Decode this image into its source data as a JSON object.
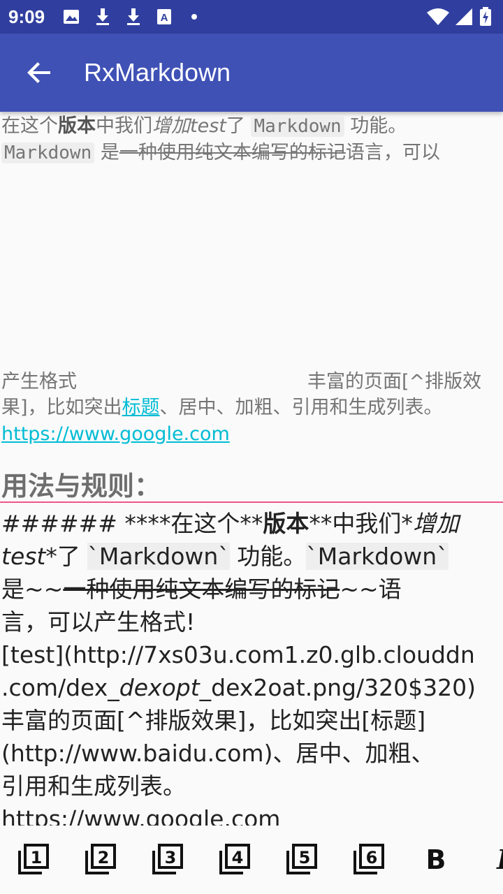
{
  "status_bar": {
    "time": "9:09",
    "icons": [
      "image-icon",
      "download-icon",
      "download-icon",
      "font-icon",
      "dot-icon",
      "wifi-icon",
      "battery-icon"
    ]
  },
  "app_bar": {
    "title": "RxMarkdown",
    "back_icon": "arrow-back-icon",
    "color": "#3f51b5",
    "status_color": "#303f9f"
  },
  "preview": {
    "line1": {
      "a": "在这个",
      "b": "版本",
      "c": "中我们",
      "d": "增加test",
      "e": "了",
      "f": "Markdown",
      "g": "功能。"
    },
    "line2": {
      "a": "Markdown",
      "b": "是",
      "c": "一种使用纯文本编写的标记",
      "d": "语言，可以"
    },
    "line3": {
      "a": "产生格式",
      "b": "丰富的页面[^排版效"
    },
    "line4": {
      "a": "果]，比如突出",
      "b": "标题",
      "c": "、居中、加粗、引用和生成列表。"
    },
    "line5": "https://www.google.com",
    "heading": "用法与规则：",
    "link_color": "#00bcd4"
  },
  "editor": {
    "lines": [
      {
        "a": "###### ",
        "b": "****",
        "c": "在这个**",
        "d": "版本",
        "e": "**中我们*",
        "f": "增加"
      },
      {
        "a": "test",
        "b": "*了 ",
        "c": "`Markdown`",
        "d": " 功能。",
        "e": "`Markdown`"
      },
      {
        "a": "是~~",
        "b": "一种使用纯文本编写的标记",
        "c": "~~语"
      },
      {
        "a": "言，可以产生格式!"
      },
      {
        "a": "[test](http://7xs03u.com1.z0.glb.clouddn"
      },
      {
        "a": ".com/dex_",
        "b": "dexopt",
        "c": "_dex2oat.png/320$320)"
      },
      {
        "a": "丰富的页面[^排版效果]，比如突出[标题]"
      },
      {
        "a": "(http://www.baidu.com)、居中、加粗、"
      },
      {
        "a": "引用和生成列表。"
      },
      {
        "a": "https://www.google.com"
      }
    ],
    "divider_color": "#e91e63"
  },
  "toolbar": {
    "items": [
      {
        "name": "header1-icon",
        "label": "1"
      },
      {
        "name": "header2-icon",
        "label": "2"
      },
      {
        "name": "header3-icon",
        "label": "3"
      },
      {
        "name": "header4-icon",
        "label": "4"
      },
      {
        "name": "header5-icon",
        "label": "5"
      },
      {
        "name": "header6-icon",
        "label": "6"
      },
      {
        "name": "bold-icon",
        "label": "B"
      },
      {
        "name": "italic-icon",
        "label": "I"
      }
    ]
  }
}
